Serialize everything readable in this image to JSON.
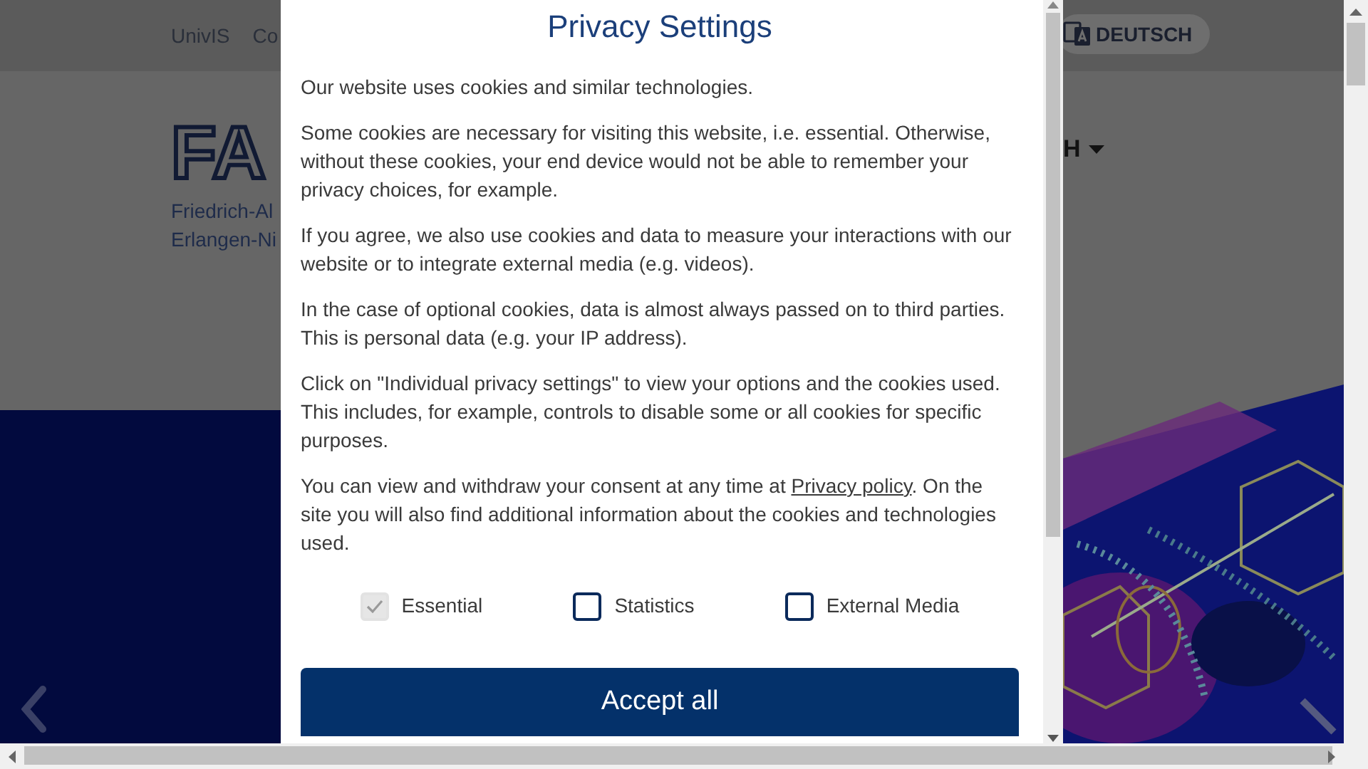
{
  "site": {
    "top_links": [
      "UnivIS",
      "Co"
    ],
    "language_button": "DEUTSCH",
    "logo": "FA",
    "logo_lines": [
      "Friedrich-Al",
      "Erlangen-Ni"
    ],
    "menu_item": "H"
  },
  "dialog": {
    "title": "Privacy Settings",
    "paragraphs": [
      {
        "text": "Our website uses cookies and similar technologies."
      },
      {
        "text": "Some cookies are necessary for visiting this website, i.e. essential. Otherwise, without these cookies, your end device would not be able to remember your privacy choices, for example."
      },
      {
        "text": "If you agree, we also use cookies and data to measure your interactions with our website or to integrate external media (e.g. videos)."
      },
      {
        "text": "In the case of optional cookies, data is almost always passed on to third parties. This is personal data (e.g. your IP address)."
      },
      {
        "text": "Click on \"Individual privacy settings\" to view your options and the cookies used. This includes, for example, controls to disable some or all cookies for specific purposes."
      },
      {
        "text": "You can view and withdraw your consent at any time at ",
        "link": "Privacy policy",
        "text_after": ". On the site you will also find additional information about the cookies and technologies used."
      }
    ],
    "options": [
      {
        "label": "Essential",
        "checked": true,
        "disabled": true
      },
      {
        "label": "Statistics",
        "checked": false,
        "disabled": false
      },
      {
        "label": "External Media",
        "checked": false,
        "disabled": false
      }
    ],
    "accept_button": "Accept all"
  }
}
